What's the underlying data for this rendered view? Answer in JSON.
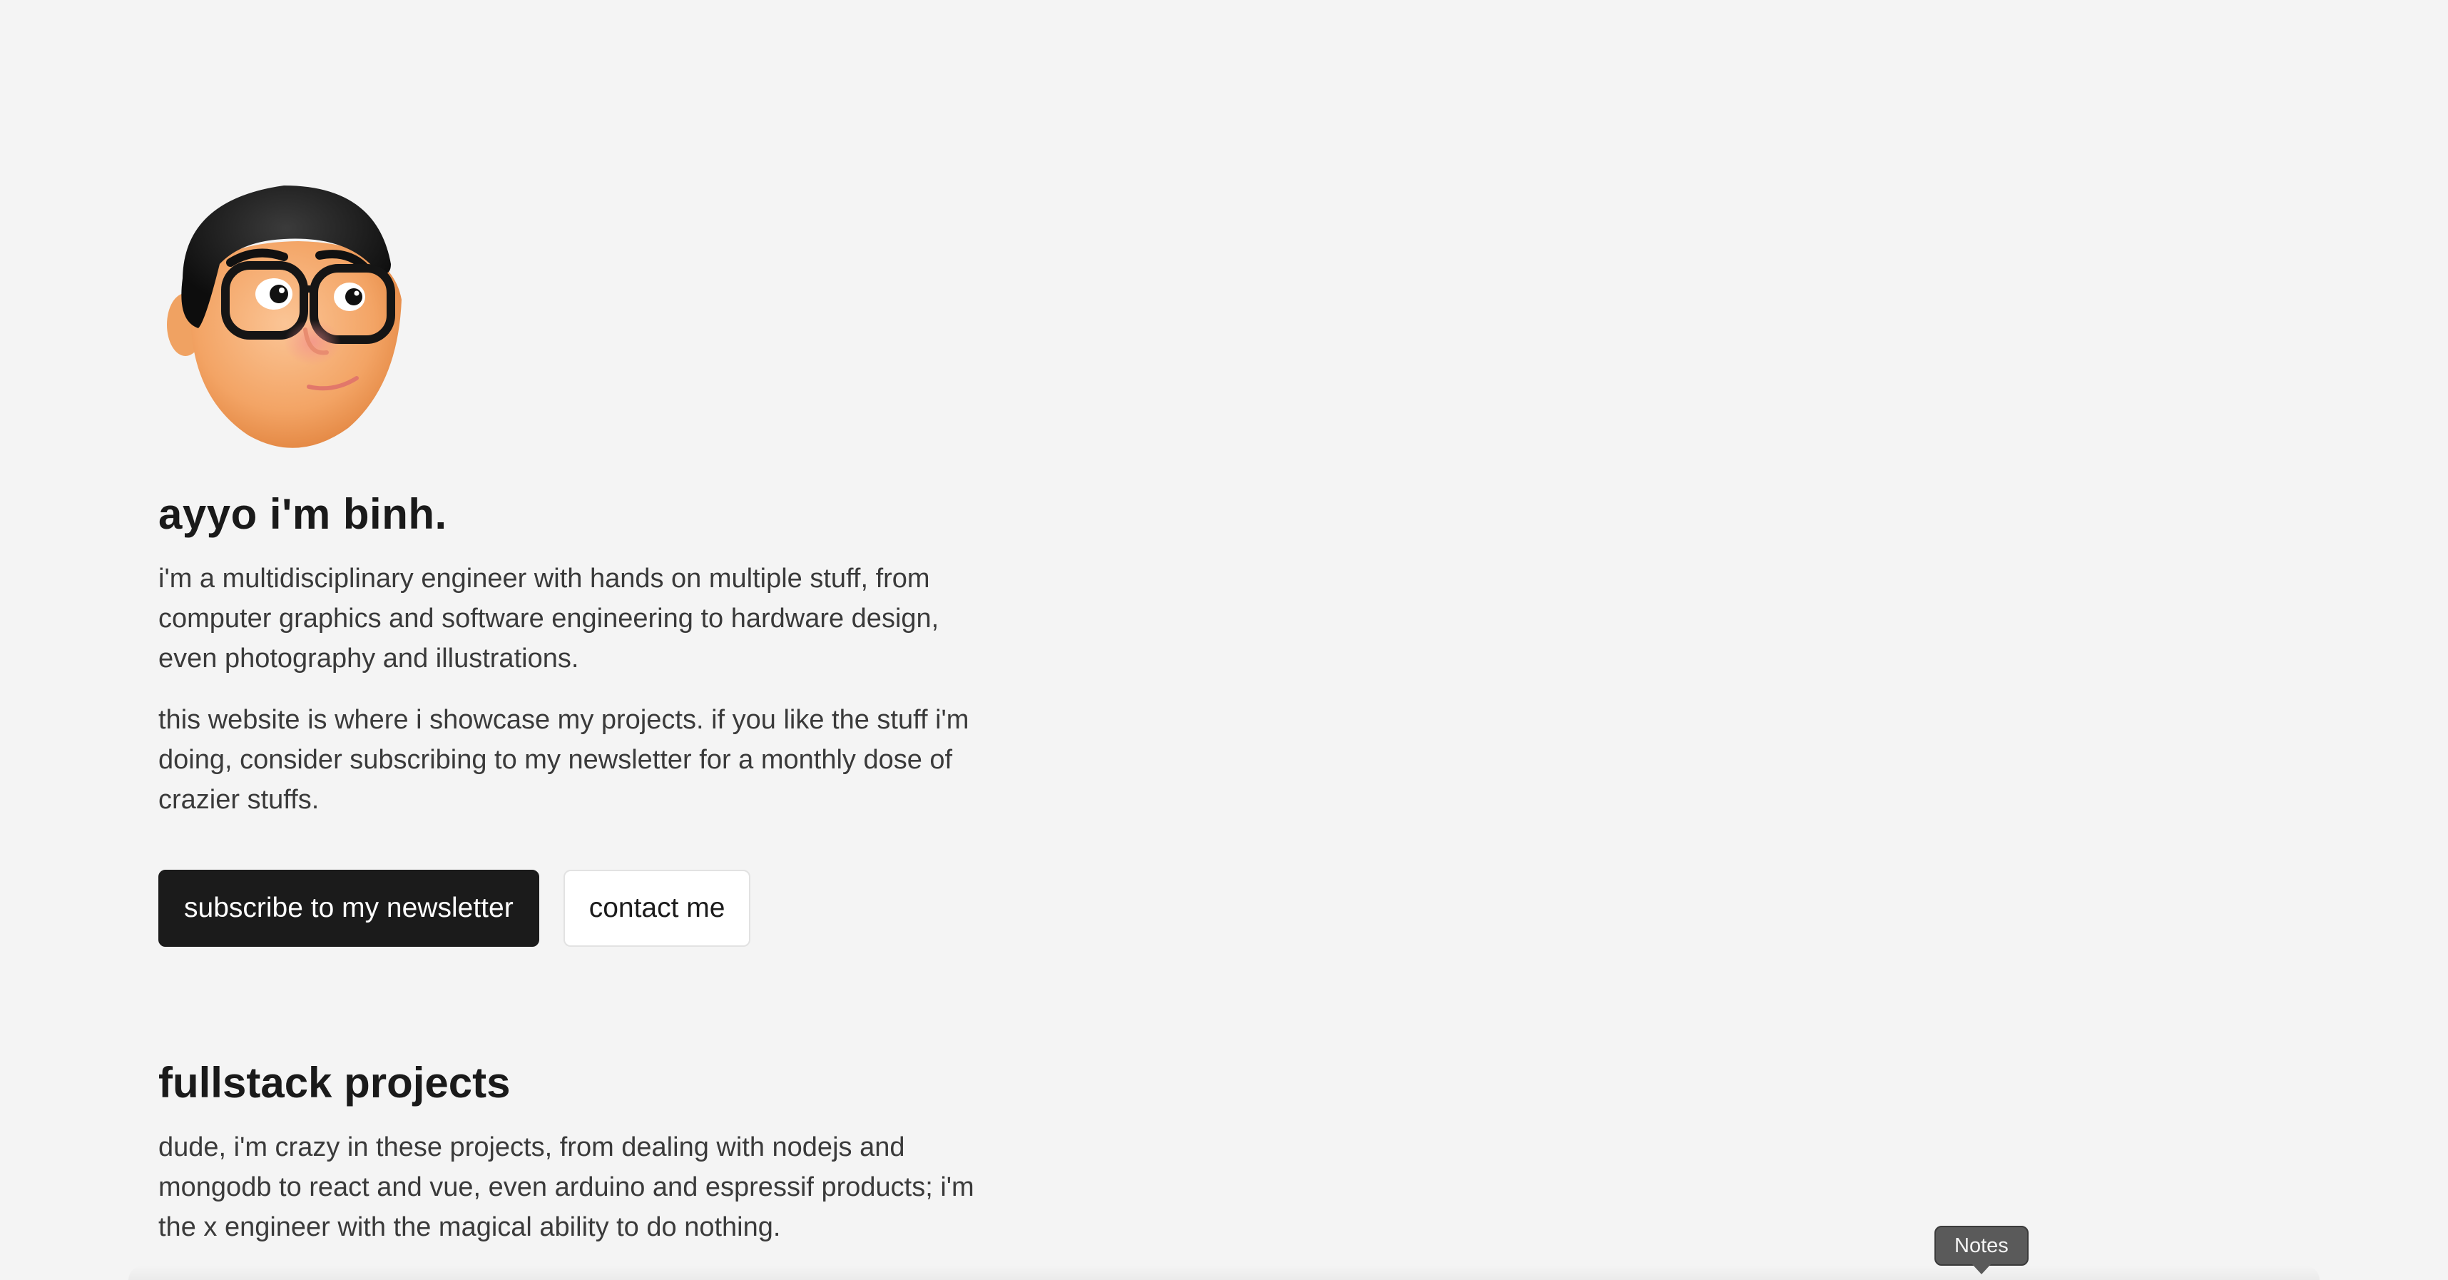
{
  "hero": {
    "title": "ayyo i'm binh.",
    "intro": "i'm a multidisciplinary engineer with hands on multiple stuff, from computer graphics and software engineering to hardware design, even photography and illustrations.",
    "showcase": "this website is where i showcase my projects. if you like the stuff i'm doing, consider subscribing to my newsletter for a monthly dose of crazier stuffs.",
    "subscribe_label": "subscribe to my newsletter",
    "contact_label": "contact me"
  },
  "fullstack": {
    "title": "fullstack projects",
    "description": "dude, i'm crazy in these projects, from dealing with nodejs and mongodb to react and vue, even arduino and espressif products; i'm the x engineer with the magical ability to do nothing."
  },
  "dock": {
    "tooltip": "Notes"
  },
  "colors": {
    "background": "#f4f4f4",
    "primary_button": "#1b1b1b",
    "text": "#1a1a1a"
  }
}
